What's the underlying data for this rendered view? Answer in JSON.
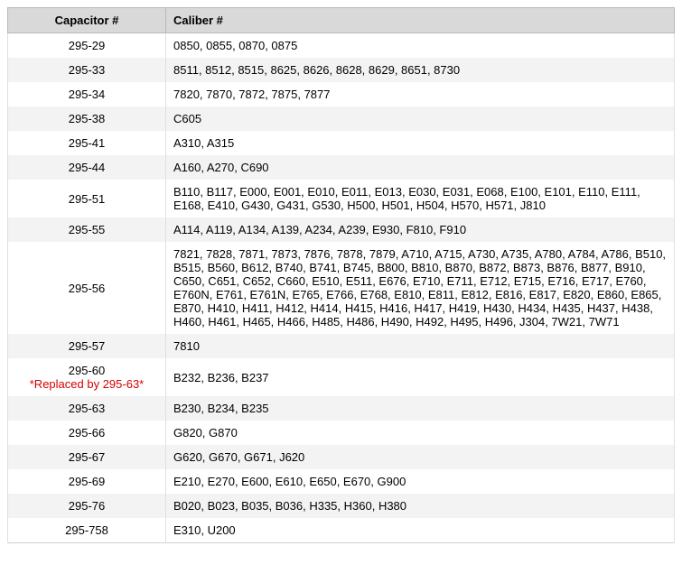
{
  "headers": {
    "capacitor": "Capacitor #",
    "caliber": "Caliber #"
  },
  "rows": [
    {
      "capacitor": "295-29",
      "note": "",
      "caliber": "0850, 0855, 0870, 0875"
    },
    {
      "capacitor": "295-33",
      "note": "",
      "caliber": "8511, 8512, 8515, 8625, 8626, 8628, 8629, 8651, 8730"
    },
    {
      "capacitor": "295-34",
      "note": "",
      "caliber": "7820, 7870, 7872, 7875, 7877"
    },
    {
      "capacitor": "295-38",
      "note": "",
      "caliber": "C605"
    },
    {
      "capacitor": "295-41",
      "note": "",
      "caliber": "A310, A315"
    },
    {
      "capacitor": "295-44",
      "note": "",
      "caliber": "A160, A270, C690"
    },
    {
      "capacitor": "295-51",
      "note": "",
      "caliber": "B110, B117, E000, E001, E010, E011, E013, E030, E031, E068, E100, E101, E110, E111, E168, E410, G430, G431, G530, H500, H501, H504, H570, H571, J810"
    },
    {
      "capacitor": "295-55",
      "note": "",
      "caliber": "A114, A119, A134, A139, A234, A239, E930, F810, F910"
    },
    {
      "capacitor": "295-56",
      "note": "",
      "caliber": "7821, 7828, 7871, 7873, 7876, 7878, 7879, A710, A715, A730, A735, A780, A784, A786, B510, B515, B560, B612, B740, B741, B745, B800, B810, B870, B872, B873, B876, B877, B910, C650, C651, C652, C660, E510, E511, E676, E710, E711, E712, E715, E716, E717, E760, E760N, E761, E761N, E765, E766, E768, E810, E811, E812, E816, E817, E820, E860, E865, E870, H410, H411, H412, H414, H415, H416, H417, H419, H430, H434, H435, H437, H438, H460, H461, H465, H466, H485, H486, H490, H492, H495, H496, J304, 7W21, 7W71"
    },
    {
      "capacitor": "295-57",
      "note": "",
      "caliber": "7810"
    },
    {
      "capacitor": "295-60",
      "note": "*Replaced by 295-63*",
      "caliber": "B232, B236, B237"
    },
    {
      "capacitor": "295-63",
      "note": "",
      "caliber": "B230, B234, B235"
    },
    {
      "capacitor": "295-66",
      "note": "",
      "caliber": "G820, G870"
    },
    {
      "capacitor": "295-67",
      "note": "",
      "caliber": "G620, G670, G671, J620"
    },
    {
      "capacitor": "295-69",
      "note": "",
      "caliber": "E210, E270, E600, E610, E650, E670, G900"
    },
    {
      "capacitor": "295-76",
      "note": "",
      "caliber": "B020, B023, B035, B036, H335, H360, H380"
    },
    {
      "capacitor": "295-758",
      "note": "",
      "caliber": "E310, U200"
    }
  ]
}
